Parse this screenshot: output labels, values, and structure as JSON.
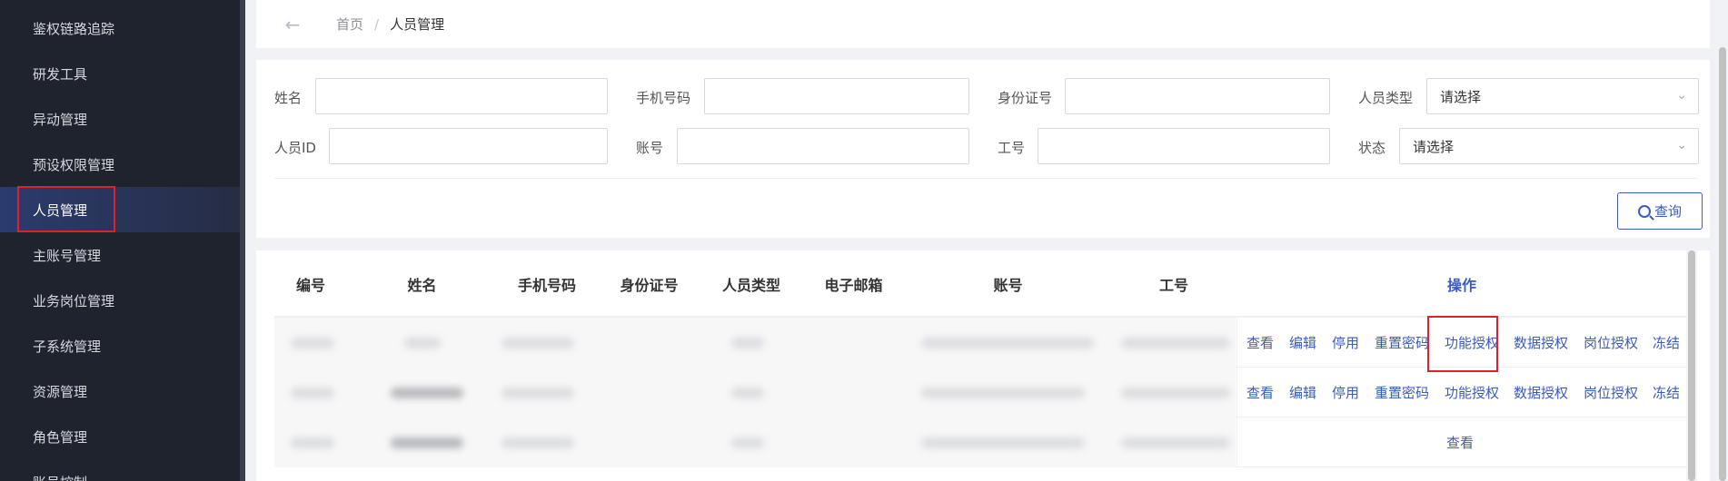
{
  "sidebar": {
    "items": [
      {
        "label": "鉴权链路追踪"
      },
      {
        "label": "研发工具"
      },
      {
        "label": "异动管理"
      },
      {
        "label": "预设权限管理"
      },
      {
        "label": "人员管理"
      },
      {
        "label": "主账号管理"
      },
      {
        "label": "业务岗位管理"
      },
      {
        "label": "子系统管理"
      },
      {
        "label": "资源管理"
      },
      {
        "label": "角色管理"
      },
      {
        "label": "账号控制"
      }
    ],
    "active_index": 4
  },
  "breadcrumb": {
    "home": "首页",
    "separator": "/",
    "current": "人员管理"
  },
  "search": {
    "name_label": "姓名",
    "phone_label": "手机号码",
    "idcard_label": "身份证号",
    "type_label": "人员类型",
    "type_value": "请选择",
    "personid_label": "人员ID",
    "account_label": "账号",
    "jobno_label": "工号",
    "status_label": "状态",
    "status_value": "请选择",
    "button_label": "查询"
  },
  "table": {
    "headers": [
      "编号",
      "姓名",
      "手机号码",
      "身份证号",
      "人员类型",
      "电子邮箱",
      "账号",
      "工号",
      "操作"
    ],
    "rows": [
      {
        "ops": [
          "查看",
          "编辑",
          "停用",
          "重置密码",
          "功能授权",
          "数据授权",
          "岗位授权",
          "冻结"
        ]
      },
      {
        "ops": [
          "查看",
          "编辑",
          "停用",
          "重置密码",
          "功能授权",
          "数据授权",
          "岗位授权",
          "冻结"
        ]
      },
      {
        "ops": [
          "查看"
        ]
      }
    ]
  },
  "colors": {
    "sidebar_bg": "#1f232e",
    "accent": "#3b5bbd",
    "highlight_box": "#e0202f"
  }
}
